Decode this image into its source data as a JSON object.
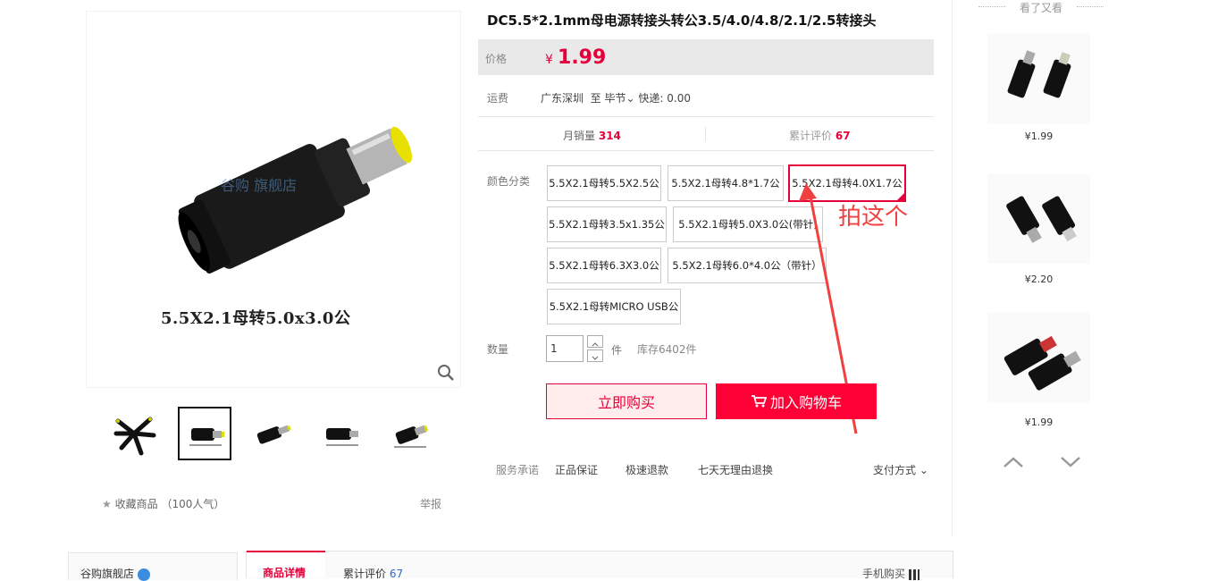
{
  "product": {
    "title": "DC5.5*2.1mm母电源转接头转公3.5/4.0/4.8/2.1/2.5转接头",
    "image_caption": "5.5X2.1母转5.0x3.0公",
    "watermark": "谷购旗舰店"
  },
  "price": {
    "label": "价格",
    "symbol": "¥",
    "value": "1.99"
  },
  "shipping": {
    "label": "运费",
    "from": "广东深圳",
    "to_prefix": "至",
    "to": "毕节",
    "express": "快递: 0.00"
  },
  "stats": {
    "sales_label": "月销量",
    "sales_value": "314",
    "reviews_label": "累计评价",
    "reviews_value": "67"
  },
  "options": {
    "label": "颜色分类",
    "items": [
      "5.5X2.1母转5.5X2.5公",
      "5.5X2.1母转4.8*1.7公",
      "5.5X2.1母转4.0X1.7公",
      "5.5X2.1母转3.5x1.35公",
      "5.5X2.1母转5.0X3.0公(带针)",
      "5.5X2.1母转6.3X3.0公",
      "5.5X2.1母转6.0*4.0公（带针）",
      "5.5X2.1母转MICRO USB公"
    ],
    "selected_index": 2
  },
  "annotation": "拍这个",
  "quantity": {
    "label": "数量",
    "value": "1",
    "unit": "件",
    "stock": "库存6402件"
  },
  "buttons": {
    "buy_now": "立即购买",
    "add_to_cart": "加入购物车"
  },
  "services": {
    "label": "服务承诺",
    "items": [
      "正品保证",
      "极速退款",
      "七天无理由退换"
    ],
    "payment": "支付方式"
  },
  "favorite": {
    "label": "收藏商品",
    "popularity": "（100人气）"
  },
  "report": "举报",
  "sidebar": {
    "title": "看了又看",
    "items": [
      {
        "price": "¥1.99"
      },
      {
        "price": "¥2.20"
      },
      {
        "price": "¥1.99"
      }
    ]
  },
  "bottom": {
    "shop": "谷购旗舰店",
    "tab_detail": "商品详情",
    "tab_reviews": "累计评价",
    "tab_reviews_count": "67",
    "mobile_buy": "手机购买"
  },
  "colors": {
    "accent": "#e4003a",
    "cart": "#ff0036",
    "annotation": "#f04040"
  }
}
